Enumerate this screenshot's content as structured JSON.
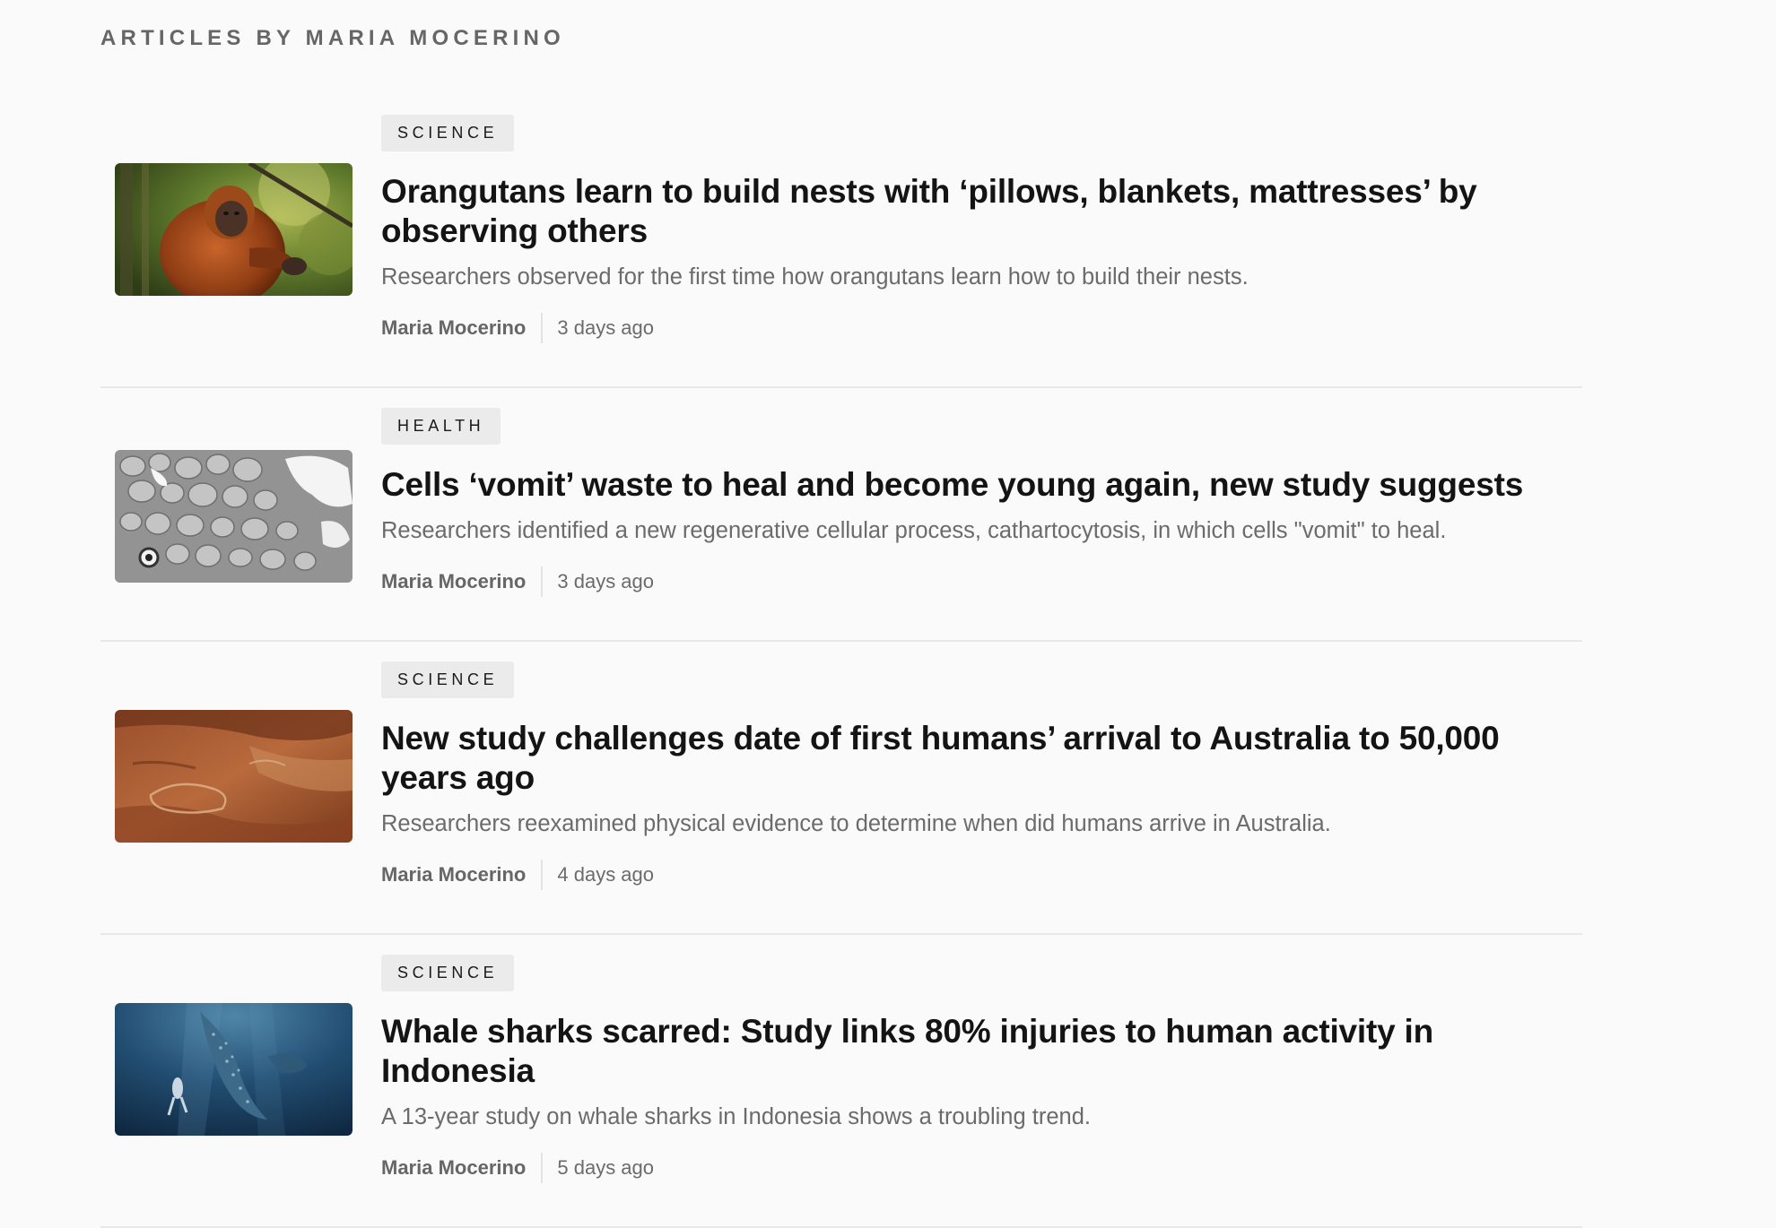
{
  "page": {
    "heading": "ARTICLES BY MARIA MOCERINO"
  },
  "articles": [
    {
      "category": "SCIENCE",
      "title": "Orangutans learn to build nests with ‘pillows, blankets, mattresses’ by observing others",
      "excerpt": "Researchers observed for the first time how orangutans learn how to build their nests.",
      "author": "Maria Mocerino",
      "time": "3 days ago",
      "image": "orangutan-photo"
    },
    {
      "category": "HEALTH",
      "title": "Cells ‘vomit’ waste to heal and become young again, new study suggests",
      "excerpt": "Researchers identified a new regenerative cellular process, cathartocytosis, in which cells \"vomit\" to heal.",
      "author": "Maria Mocerino",
      "time": "3 days ago",
      "image": "cell-micrograph"
    },
    {
      "category": "SCIENCE",
      "title": "New study challenges date of first humans’ arrival to Australia to 50,000 years ago",
      "excerpt": "Researchers reexamined physical evidence to determine when did humans arrive in Australia.",
      "author": "Maria Mocerino",
      "time": "4 days ago",
      "image": "rock-art-photo"
    },
    {
      "category": "SCIENCE",
      "title": "Whale sharks scarred: Study links 80% injuries to human activity in Indonesia",
      "excerpt": "A 13-year study on whale sharks in Indonesia shows a troubling trend.",
      "author": "Maria Mocerino",
      "time": "5 days ago",
      "image": "whale-shark-photo"
    }
  ]
}
